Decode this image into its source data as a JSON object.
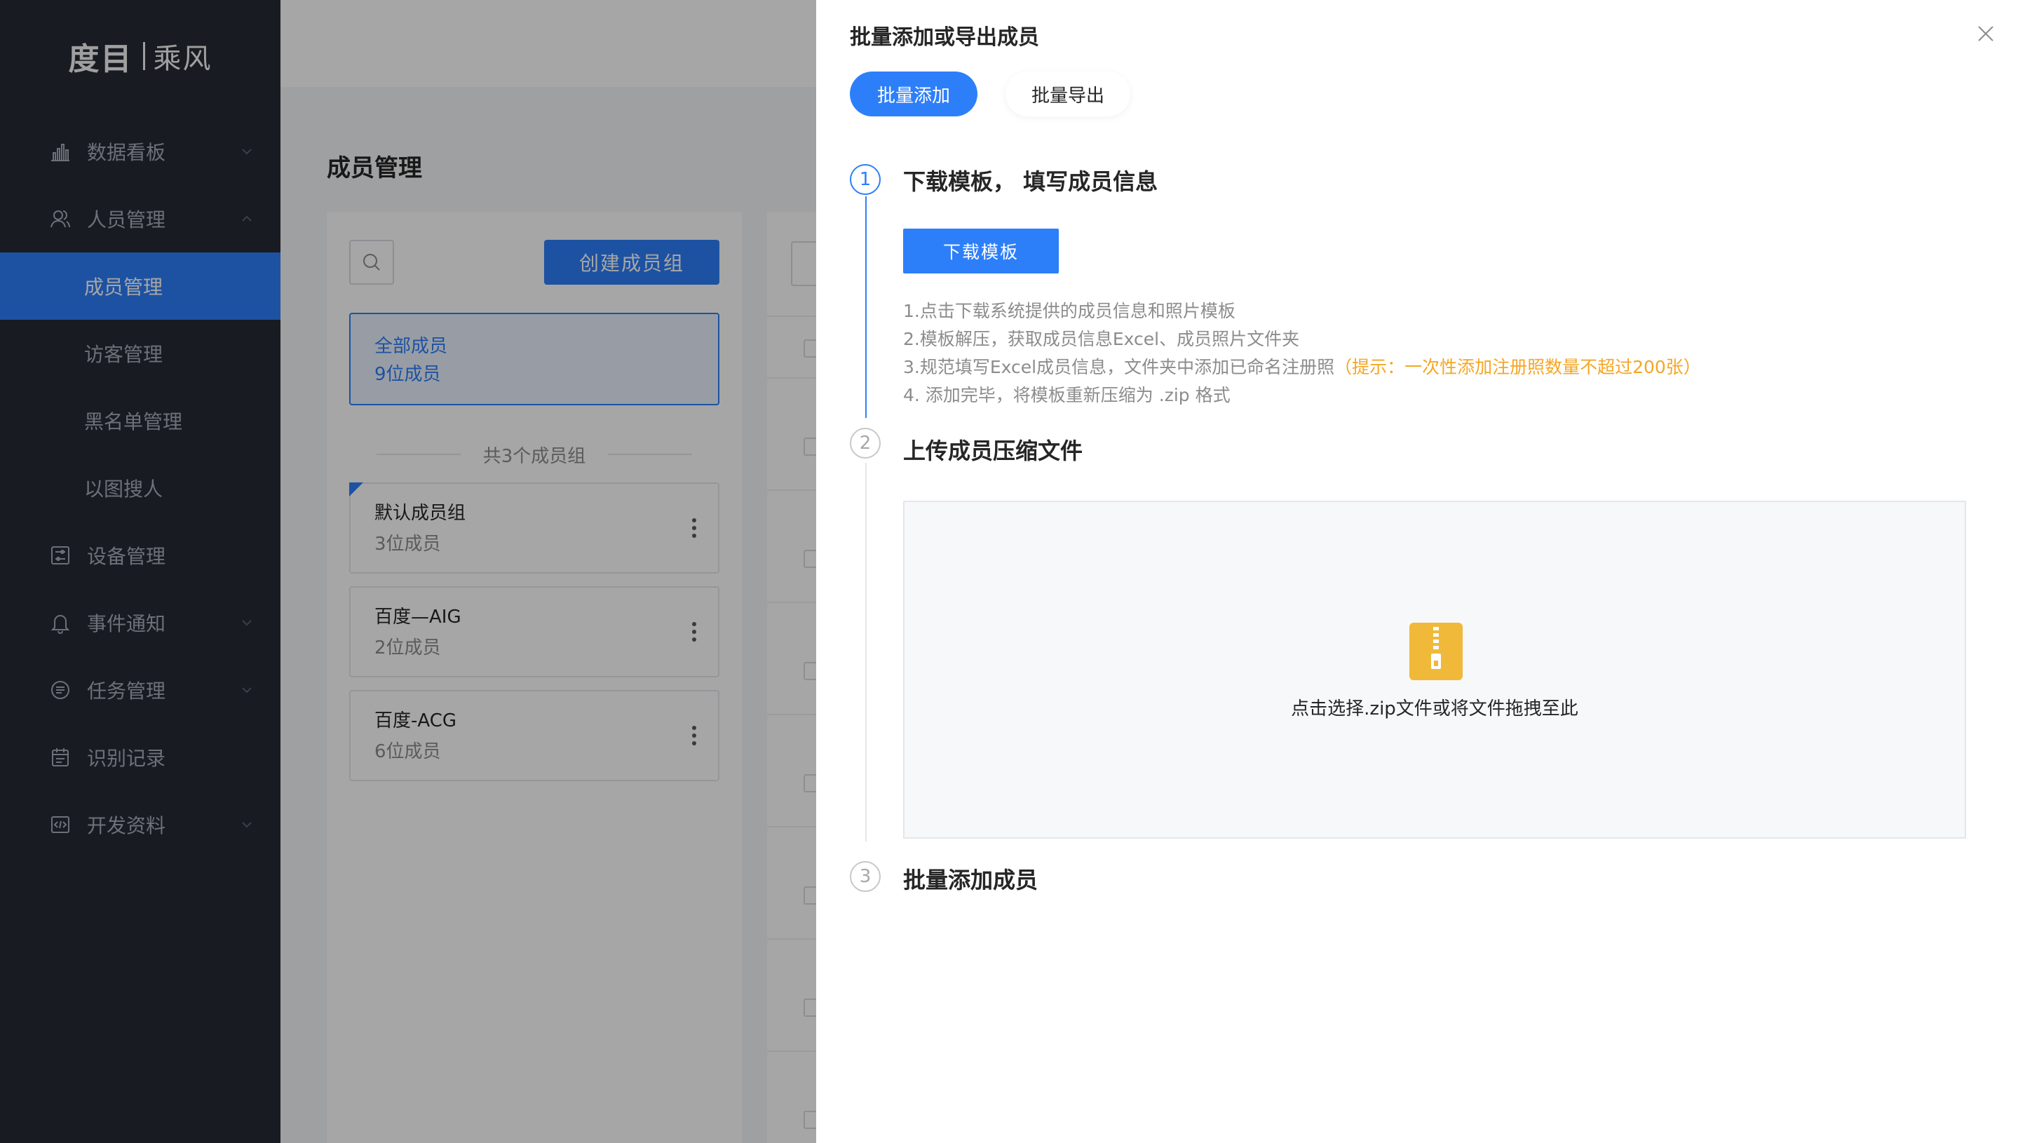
{
  "sidebar": {
    "logo_main": "度目",
    "logo_sub": "乘风",
    "items": [
      {
        "label": "数据看板"
      },
      {
        "label": "人员管理"
      },
      {
        "label": "设备管理"
      },
      {
        "label": "事件通知"
      },
      {
        "label": "任务管理"
      },
      {
        "label": "识别记录"
      },
      {
        "label": "开发资料"
      }
    ],
    "subitems": [
      {
        "label": "成员管理"
      },
      {
        "label": "访客管理"
      },
      {
        "label": "黑名单管理"
      },
      {
        "label": "以图搜人"
      }
    ]
  },
  "main": {
    "title": "成员管理",
    "create_button": "创建成员组",
    "all_members": {
      "title": "全部成员",
      "count": "9位成员"
    },
    "groups_total": "共3个成员组",
    "groups": [
      {
        "name": "默认成员组",
        "count": "3位成员"
      },
      {
        "name": "百度—AIG",
        "count": "2位成员"
      },
      {
        "name": "百度-ACG",
        "count": "6位成员"
      }
    ]
  },
  "drawer": {
    "title": "批量添加或导出成员",
    "tabs": [
      {
        "label": "批量添加"
      },
      {
        "label": "批量导出"
      }
    ],
    "steps": [
      {
        "num": "1",
        "title": "下载模板，  填写成员信息"
      },
      {
        "num": "2",
        "title": "上传成员压缩文件"
      },
      {
        "num": "3",
        "title": "批量添加成员"
      }
    ],
    "download_button": "下载模板",
    "instructions": {
      "line1": "1.点击下载系统提供的成员信息和照片模板",
      "line2": "2.模板解压，获取成员信息Excel、成员照片文件夹",
      "line3": "3.规范填写Excel成员信息，文件夹中添加已命名注册照",
      "line3_tip": "（提示：一次性添加注册照数量不超过200张）",
      "line4": "4. 添加完毕，将模板重新压缩为 .zip 格式"
    },
    "upload_text": "点击选择.zip文件或将文件拖拽至此"
  },
  "colors": {
    "primary": "#2d7ff9",
    "sidebar_bg": "#262a35",
    "tip": "#f5a623",
    "zip_icon": "#f0b93a"
  }
}
